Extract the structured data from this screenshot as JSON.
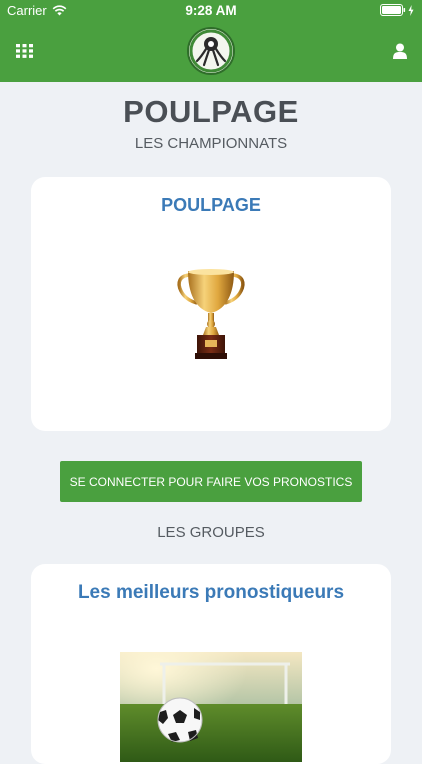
{
  "status": {
    "carrier": "Carrier",
    "time": "9:28 AM"
  },
  "header": {
    "menu_icon": "grid-icon",
    "user_icon": "user-icon",
    "logo_icon": "octopus-logo"
  },
  "main": {
    "title": "POULPAGE",
    "subtitle": "LES CHAMPIONNATS",
    "championship_card": {
      "title": "POULPAGE",
      "icon": "trophy-icon"
    },
    "login_button": "SE CONNECTER POUR FAIRE VOS PRONOSTICS",
    "groups_heading": "LES GROUPES",
    "group_card": {
      "title": "Les meilleurs pronostiqueurs",
      "image": "soccer-ball-photo"
    }
  },
  "colors": {
    "brand_green": "#4aa03f",
    "title_blue": "#3b7ab7",
    "background": "#eef1f5"
  }
}
